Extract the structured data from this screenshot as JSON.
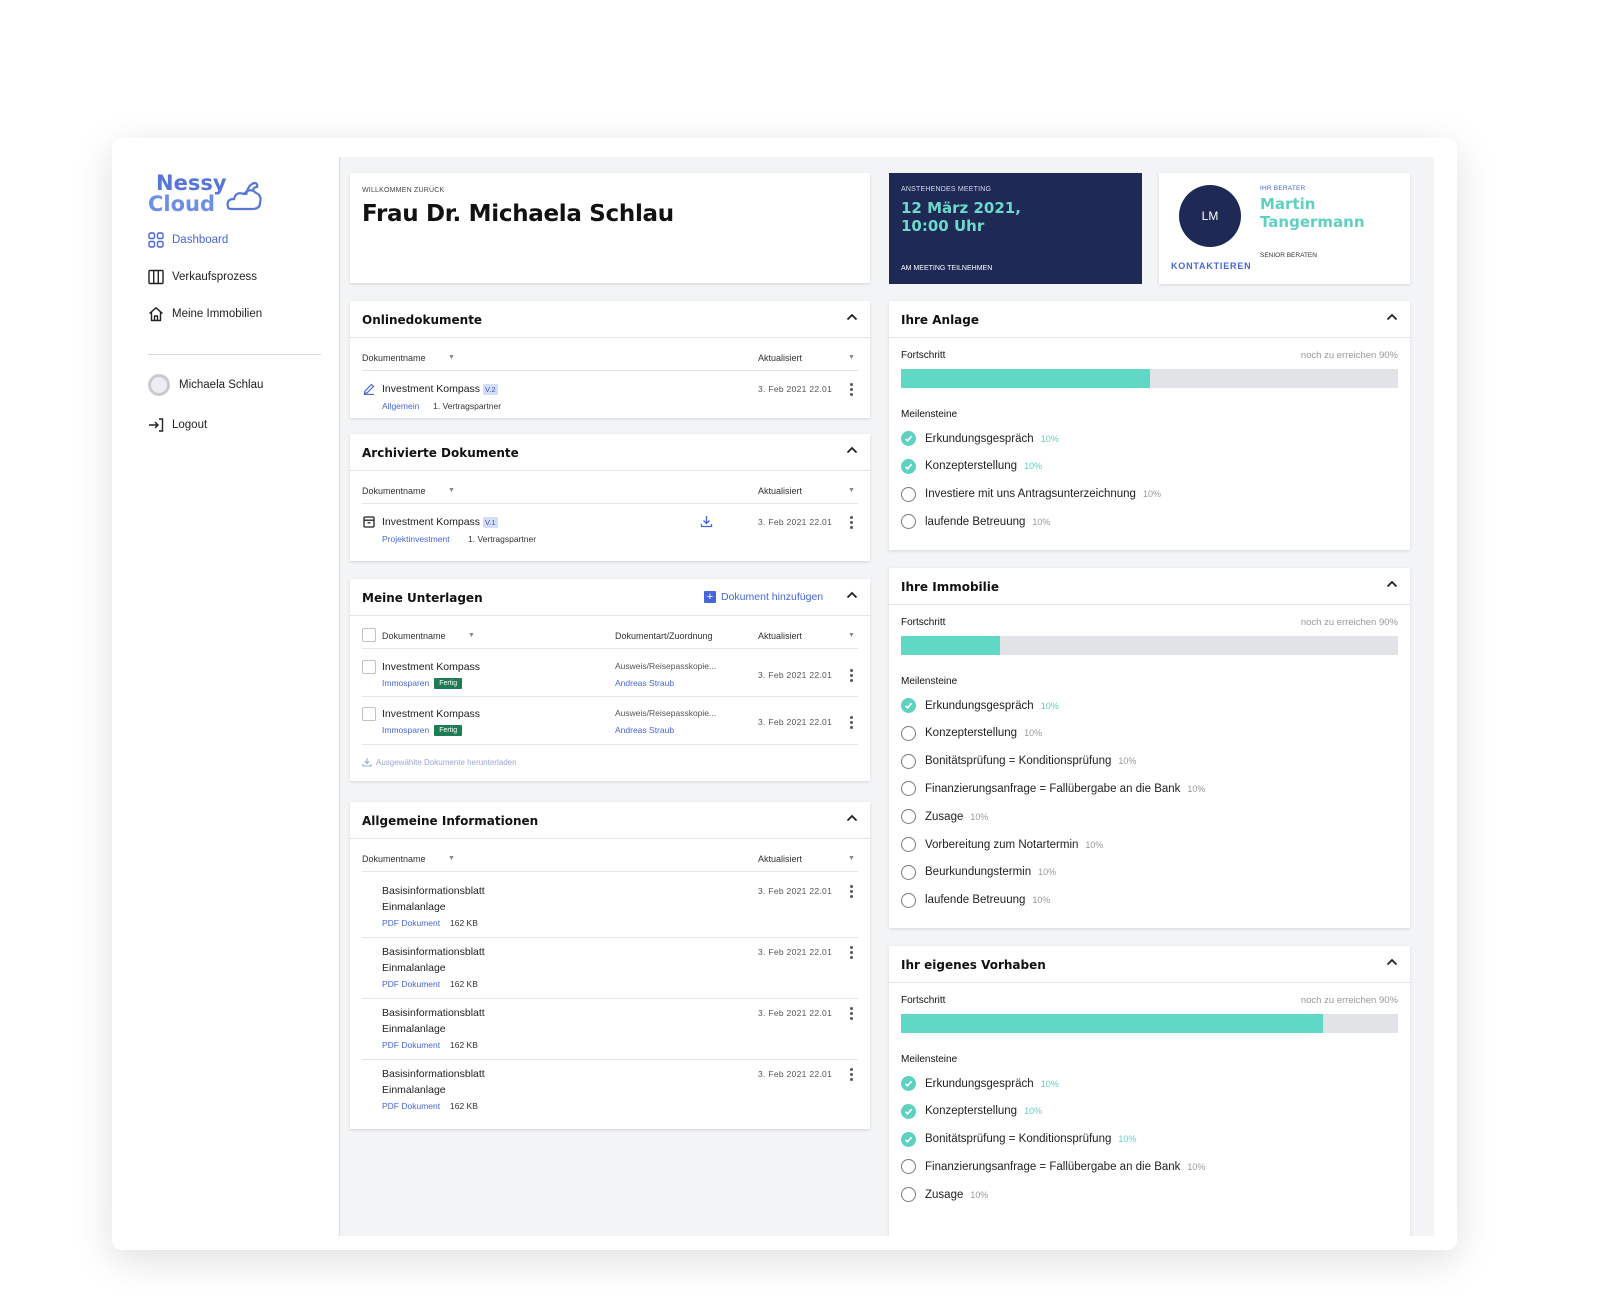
{
  "app": {
    "logo_line1": "Nessy",
    "logo_line2": "Cloud"
  },
  "sidebar": {
    "items": [
      {
        "label": "Dashboard"
      },
      {
        "label": "Verkaufsprozess"
      },
      {
        "label": "Meine Immobilien"
      }
    ],
    "user_name": "Michaela Schlau",
    "logout": "Logout"
  },
  "welcome": {
    "kicker": "Willkommen zurück",
    "name": "Frau Dr. Michaela Schlau"
  },
  "meeting": {
    "kicker": "Anstehendes Meeting",
    "date_line1": "12 März 2021,",
    "date_line2": "10:00 Uhr",
    "join": "Am Meeting teilnehmen"
  },
  "advisor": {
    "initials": "LM",
    "kicker": "Ihr Berater",
    "first": "Martin",
    "last": "Tangermann",
    "title": "Senior Beraten",
    "contact": "KONTAKTIEREN"
  },
  "online_docs": {
    "title": "Onlinedokumente",
    "col_name": "Dokumentname",
    "col_updated": "Aktualisiert",
    "rows": [
      {
        "name": "Investment Kompass",
        "version": "V.2",
        "category": "Allgemein",
        "party": "1. Vertragspartner",
        "date": "3. Feb 2021 22.01"
      }
    ]
  },
  "archived_docs": {
    "title": "Archivierte Dokumente",
    "col_name": "Dokumentname",
    "col_updated": "Aktualisiert",
    "rows": [
      {
        "name": "Investment Kompass",
        "version": "V.1",
        "category": "Projektinvestment",
        "party": "1. Vertragspartner",
        "date": "3. Feb 2021 22.01"
      }
    ]
  },
  "my_docs": {
    "title": "Meine Unterlagen",
    "add_label": "Dokument hinzufügen",
    "col_name": "Dokumentname",
    "col_type": "Dokumentart/Zuordnung",
    "col_updated": "Aktualisiert",
    "rows": [
      {
        "name": "Investment Kompass",
        "category": "Immosparen",
        "status": "Fertig",
        "type": "Ausweis/Reisepasskopie...",
        "person": "Andreas Straub",
        "date": "3. Feb 2021 22.01"
      },
      {
        "name": "Investment Kompass",
        "category": "Immosparen",
        "status": "Fertig",
        "type": "Ausweis/Reisepasskopie...",
        "person": "Andreas Straub",
        "date": "3. Feb 2021 22.01"
      }
    ],
    "download_selected": "Ausgewählte Dokumente herunterladen"
  },
  "general_info": {
    "title": "Allgemeine Informationen",
    "col_name": "Dokumentname",
    "col_updated": "Aktualisiert",
    "rows": [
      {
        "line1": "Basisinformationsblatt",
        "line2": "Einmalanlage",
        "type": "PDF Dokument",
        "size": "162 KB",
        "date": "3. Feb 2021 22.01"
      },
      {
        "line1": "Basisinformationsblatt",
        "line2": "Einmalanlage",
        "type": "PDF Dokument",
        "size": "162 KB",
        "date": "3. Feb 2021 22.01"
      },
      {
        "line1": "Basisinformationsblatt",
        "line2": "Einmalanlage",
        "type": "PDF Dokument",
        "size": "162 KB",
        "date": "3. Feb 2021 22.01"
      },
      {
        "line1": "Basisinformationsblatt",
        "line2": "Einmalanlage",
        "type": "PDF Dokument",
        "size": "162 KB",
        "date": "3. Feb 2021 22.01"
      }
    ]
  },
  "anlage": {
    "title": "Ihre Anlage",
    "progress_label": "Fortschritt",
    "remaining": "noch zu erreichen 90%",
    "progress": 0.5,
    "milestones_label": "Meilensteine",
    "milestones": [
      {
        "label": "Erkundungsgespräch",
        "pct": "10%",
        "done": true
      },
      {
        "label": "Konzepterstellung",
        "pct": "10%",
        "done": true
      },
      {
        "label": "Investiere mit uns Antragsunterzeichnung",
        "pct": "10%",
        "done": false
      },
      {
        "label": "laufende Betreuung",
        "pct": "10%",
        "done": false
      }
    ]
  },
  "immobilie": {
    "title": "Ihre Immobilie",
    "progress_label": "Fortschritt",
    "remaining": "noch zu erreichen 90%",
    "progress": 0.2,
    "milestones_label": "Meilensteine",
    "milestones": [
      {
        "label": "Erkundungsgespräch",
        "pct": "10%",
        "done": true
      },
      {
        "label": "Konzepterstellung",
        "pct": "10%",
        "done": false
      },
      {
        "label": "Bonitätsprüfung = Konditionsprüfung",
        "pct": "10%",
        "done": false
      },
      {
        "label": "Finanzierungsanfrage = Fallübergabe an die Bank",
        "pct": "10%",
        "done": false
      },
      {
        "label": "Zusage",
        "pct": "10%",
        "done": false
      },
      {
        "label": "Vorbereitung zum Notartermin",
        "pct": "10%",
        "done": false
      },
      {
        "label": "Beurkundungstermin",
        "pct": "10%",
        "done": false
      },
      {
        "label": "laufende Betreuung",
        "pct": "10%",
        "done": false
      }
    ]
  },
  "vorhaben": {
    "title": "Ihr eigenes Vorhaben",
    "progress_label": "Fortschritt",
    "remaining": "noch zu erreichen 90%",
    "progress": 0.85,
    "milestones_label": "Meilensteine",
    "milestones": [
      {
        "label": "Erkundungsgespräch",
        "pct": "10%",
        "done": true
      },
      {
        "label": "Konzepterstellung",
        "pct": "10%",
        "done": true
      },
      {
        "label": "Bonitätsprüfung = Konditionsprüfung",
        "pct": "10%",
        "done": true
      },
      {
        "label": "Finanzierungsanfrage = Fallübergabe an die Bank",
        "pct": "10%",
        "done": false
      },
      {
        "label": "Zusage",
        "pct": "10%",
        "done": false
      }
    ]
  },
  "colors": {
    "accent": "#4766d9",
    "teal": "#5fd8c6",
    "navy": "#1e2a55",
    "badge": "#1e7b52"
  }
}
